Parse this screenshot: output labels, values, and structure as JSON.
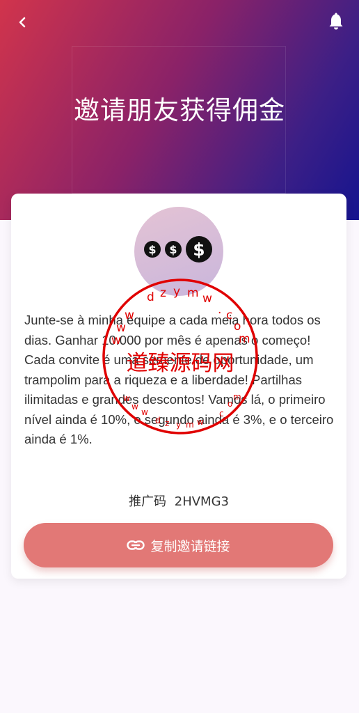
{
  "header": {
    "title": "邀请朋友获得佣金",
    "back_icon": "chevron-left-icon",
    "notification_icon": "bell-icon"
  },
  "card": {
    "description": "Junte-se à minha equipe a cada meia hora todos os dias. Ganhar 10.000 por mês é apenas o começo! Cada convite é uma semente de oportunidade, um trampolim para a riqueza e a liberdade! Partilhas ilimitadas e grandes descontos! Vamos lá, o primeiro nível ainda é 10%, o segundo ainda é 3%, e o terceiro ainda é 1%.",
    "promo_label": "推广码",
    "promo_code": "2HVMG3",
    "copy_button_label": "复制邀请链接"
  },
  "watermark": {
    "center_text": "道臻源码网",
    "ring_text": "dzymw.com",
    "color": "#e00000"
  },
  "colors": {
    "accent": "#e27876",
    "hero_start": "#d1344c",
    "hero_end": "#15148f"
  }
}
